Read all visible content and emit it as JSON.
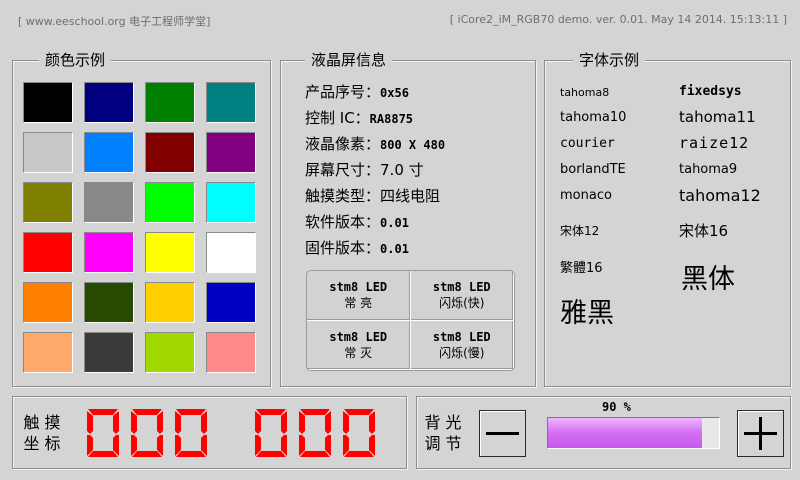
{
  "header": {
    "left": "[ www.eeschool.org  电子工程师学堂]",
    "right": "[ iCore2_iM_RGB70 demo.  ver. 0.01. May 14 2014. 15:13:11 ]"
  },
  "colors_panel": {
    "title": "颜色示例",
    "swatches": [
      "#000000",
      "#000080",
      "#008000",
      "#008080",
      "#c8c8c8",
      "#0080ff",
      "#800000",
      "#800080",
      "#808000",
      "#888888",
      "#00ff00",
      "#00ffff",
      "#ff0000",
      "#ff00ff",
      "#ffff00",
      "#ffffff",
      "#ff8000",
      "#254a00",
      "#ffd000",
      "#0000c0",
      "#ffaa6a",
      "#3a3a3a",
      "#a0d800",
      "#ff8888"
    ]
  },
  "lcd_panel": {
    "title": "液晶屏信息",
    "rows": [
      {
        "label": "产品序号：",
        "value": "0x56"
      },
      {
        "label": "控制 IC：",
        "value": "RA8875"
      },
      {
        "label": "液晶像素：",
        "value": "800 X 480"
      },
      {
        "label": "屏幕尺寸：",
        "value": "7.0 寸"
      },
      {
        "label": "触摸类型：",
        "value": "四线电阻"
      },
      {
        "label": "软件版本：",
        "value": "0.01"
      },
      {
        "label": "固件版本：",
        "value": "0.01"
      }
    ],
    "led_buttons": [
      {
        "line1": "stm8 LED",
        "line2": "常   亮"
      },
      {
        "line1": "stm8 LED",
        "line2": "闪烁(快)"
      },
      {
        "line1": "stm8 LED",
        "line2": "常   灭"
      },
      {
        "line1": "stm8 LED",
        "line2": "闪烁(慢)"
      }
    ]
  },
  "fonts_panel": {
    "title": "字体示例",
    "tahoma8": "tahoma8",
    "fixedsys": "fixedsys",
    "tahoma10": "tahoma10",
    "tahoma11": "tahoma11",
    "courier": "courier",
    "raize12": "raize12",
    "borlandte": "borlandTE",
    "tahoma9": "tahoma9",
    "monaco": "monaco",
    "tahoma12": "tahoma12",
    "song12": "宋体12",
    "song16": "宋体16",
    "fanti16": "繁體16",
    "heiti": "黑体",
    "yahei": "雅黑"
  },
  "touch_panel": {
    "label_line1": "触 摸",
    "label_line2": "坐 标",
    "x_value": "000",
    "y_value": "000",
    "segment_color": "#ff0000"
  },
  "brightness_panel": {
    "label_line1": "背 光",
    "label_line2": "调 节",
    "percent_text": "90 %",
    "level": 0.9,
    "minus_icon": "minus-icon",
    "plus_icon": "plus-icon"
  }
}
